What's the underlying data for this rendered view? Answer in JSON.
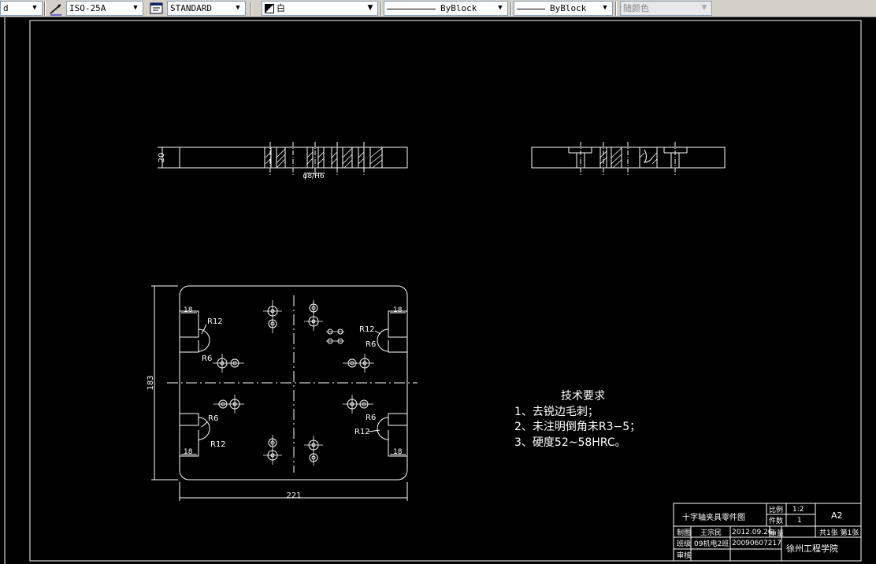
{
  "toolbar": {
    "first_dropdown": "d",
    "dimstyle": "ISO-25A",
    "textstyle": "STANDARD",
    "color": "白",
    "linetype": "ByBlock",
    "lineweight": "ByBlock",
    "plotstyle": "随颜色"
  },
  "drawing": {
    "dims": {
      "top_thickness": "20",
      "small_hole": "φ8/H6",
      "height": "183",
      "width": "221",
      "r12_tl": "R12",
      "r6_tl": "R6",
      "r12_tr": "R12",
      "r6_tr": "R6",
      "r6_bl": "R6",
      "r12_bl": "R12",
      "r6_br": "R6",
      "r12_br": "R12",
      "d18_tl": "18",
      "d18_tr": "18",
      "d18_bl": "18",
      "d18_br": "18"
    },
    "requirements": {
      "title": "技术要求",
      "items": [
        "1、去锐边毛刺；",
        "2、未注明倒角未R3−5；",
        "3、硬度52~58HRC。"
      ]
    },
    "title_block": {
      "name": "十字轴夹具零件图",
      "scale_label": "比例",
      "scale": "1:2",
      "qty_label": "件数",
      "qty": "1",
      "sheet_size": "A2",
      "drawn_label": "制图",
      "drawn_by": "王宗民",
      "date": "2012.09.26",
      "weight_label": "重量",
      "sheets": "共1张  第1张",
      "class_label": "班级",
      "class": "09机电2班",
      "student_id": "20090607217",
      "check_label": "审核",
      "school": "徐州工程学院"
    }
  }
}
